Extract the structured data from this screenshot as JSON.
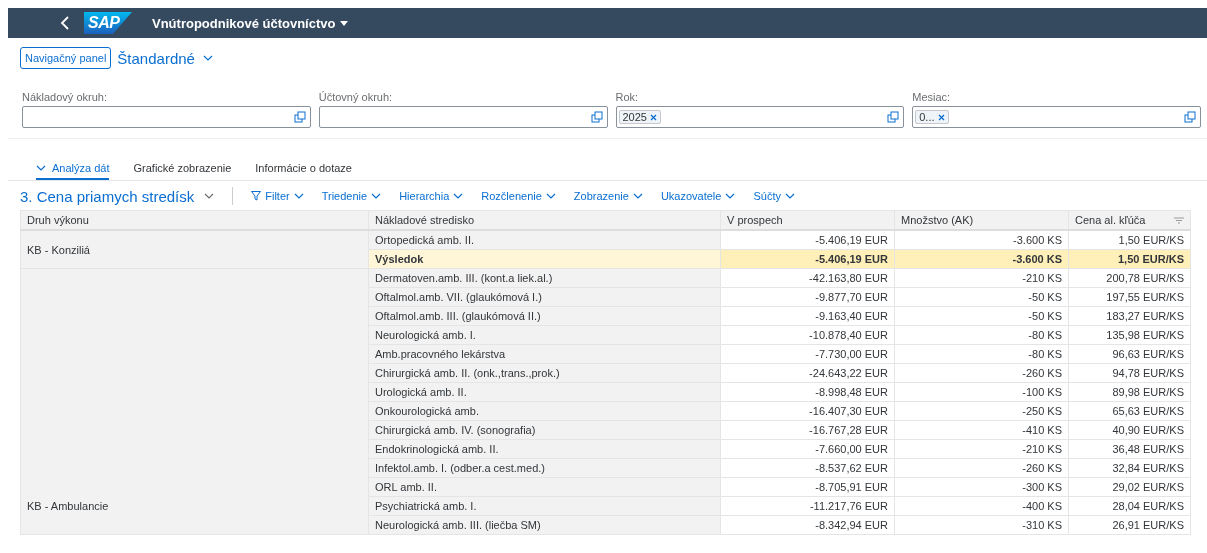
{
  "shell": {
    "logo": "SAP",
    "title": "Vnútropodnikové účtovníctvo"
  },
  "variant": {
    "nav_button": "Navigačný panel",
    "name": "Štandardné"
  },
  "filters": [
    {
      "label": "Nákladový okruh:"
    },
    {
      "label": "Účtovný okruh:"
    },
    {
      "label": "Rok:",
      "tokens": [
        "2025"
      ]
    },
    {
      "label": "Mesiac:",
      "tokens": [
        "0..."
      ]
    }
  ],
  "tabs": [
    {
      "label": "Analýza dát",
      "selected": true
    },
    {
      "label": "Grafické zobrazenie",
      "selected": false
    },
    {
      "label": "Informácie o dotaze",
      "selected": false
    }
  ],
  "toolbar": {
    "query": "3. Cena priamych stredísk",
    "menus": [
      {
        "label": "Filter",
        "kind": "filter"
      },
      {
        "label": "Triedenie",
        "kind": "menu"
      },
      {
        "label": "Hierarchia",
        "kind": "menu"
      },
      {
        "label": "Rozčlenenie",
        "kind": "menu"
      },
      {
        "label": "Zobrazenie",
        "kind": "menu"
      },
      {
        "label": "Ukazovatele",
        "kind": "menu"
      },
      {
        "label": "Súčty",
        "kind": "menu"
      }
    ]
  },
  "table": {
    "columns": [
      "Druh výkonu",
      "Nákladové stredisko",
      "V prospech",
      "Množstvo (AK)",
      "Cena al. kľúča"
    ],
    "groups": [
      {
        "label": "KB - Konziliá",
        "rows": [
          {
            "kind": "item",
            "center": "Ortopedická amb. II.",
            "credit": "-5.406,19 EUR",
            "qty": "-3.600 KS",
            "price": "1,50 EUR/KS"
          },
          {
            "kind": "result",
            "center": "Výsledok",
            "credit": "-5.406,19 EUR",
            "qty": "-3.600 KS",
            "price": "1,50 EUR/KS"
          }
        ]
      },
      {
        "label": "KB - Ambulancie",
        "rows": [
          {
            "kind": "item",
            "center": "Dermatoven.amb. III. (kont.a liek.al.)",
            "credit": "-42.163,80 EUR",
            "qty": "-210 KS",
            "price": "200,78 EUR/KS"
          },
          {
            "kind": "item",
            "center": "Oftalmol.amb. VII. (glaukómová I.)",
            "credit": "-9.877,70 EUR",
            "qty": "-50 KS",
            "price": "197,55 EUR/KS"
          },
          {
            "kind": "item",
            "center": "Oftalmol.amb. III. (glaukómová II.)",
            "credit": "-9.163,40 EUR",
            "qty": "-50 KS",
            "price": "183,27 EUR/KS"
          },
          {
            "kind": "item",
            "center": "Neurologická amb. I.",
            "credit": "-10.878,40 EUR",
            "qty": "-80 KS",
            "price": "135,98 EUR/KS"
          },
          {
            "kind": "item",
            "center": "Amb.pracovného lekárstva",
            "credit": "-7.730,00 EUR",
            "qty": "-80 KS",
            "price": "96,63 EUR/KS"
          },
          {
            "kind": "item",
            "center": "Chirurgická amb. II. (onk.,trans.,prok.)",
            "credit": "-24.643,22 EUR",
            "qty": "-260 KS",
            "price": "94,78 EUR/KS"
          },
          {
            "kind": "item",
            "center": "Urologická amb. II.",
            "credit": "-8.998,48 EUR",
            "qty": "-100 KS",
            "price": "89,98 EUR/KS"
          },
          {
            "kind": "item",
            "center": "Onkourologická amb.",
            "credit": "-16.407,30 EUR",
            "qty": "-250 KS",
            "price": "65,63 EUR/KS"
          },
          {
            "kind": "item",
            "center": "Chirurgická amb. IV. (sonografia)",
            "credit": "-16.767,28 EUR",
            "qty": "-410 KS",
            "price": "40,90 EUR/KS"
          },
          {
            "kind": "item",
            "center": "Endokrinologická amb. II.",
            "credit": "-7.660,00 EUR",
            "qty": "-210 KS",
            "price": "36,48 EUR/KS"
          },
          {
            "kind": "item",
            "center": "Infektol.amb. I. (odber.a cest.med.)",
            "credit": "-8.537,62 EUR",
            "qty": "-260 KS",
            "price": "32,84 EUR/KS"
          },
          {
            "kind": "item",
            "center": "ORL amb. II.",
            "credit": "-8.705,91 EUR",
            "qty": "-300 KS",
            "price": "29,02 EUR/KS"
          },
          {
            "kind": "item",
            "center": "Psychiatrická amb. I.",
            "credit": "-11.217,76 EUR",
            "qty": "-400 KS",
            "price": "28,04 EUR/KS"
          },
          {
            "kind": "item",
            "center": "Neurologická amb. III. (liečba SM)",
            "credit": "-8.342,94 EUR",
            "qty": "-310 KS",
            "price": "26,91 EUR/KS"
          }
        ]
      }
    ]
  }
}
